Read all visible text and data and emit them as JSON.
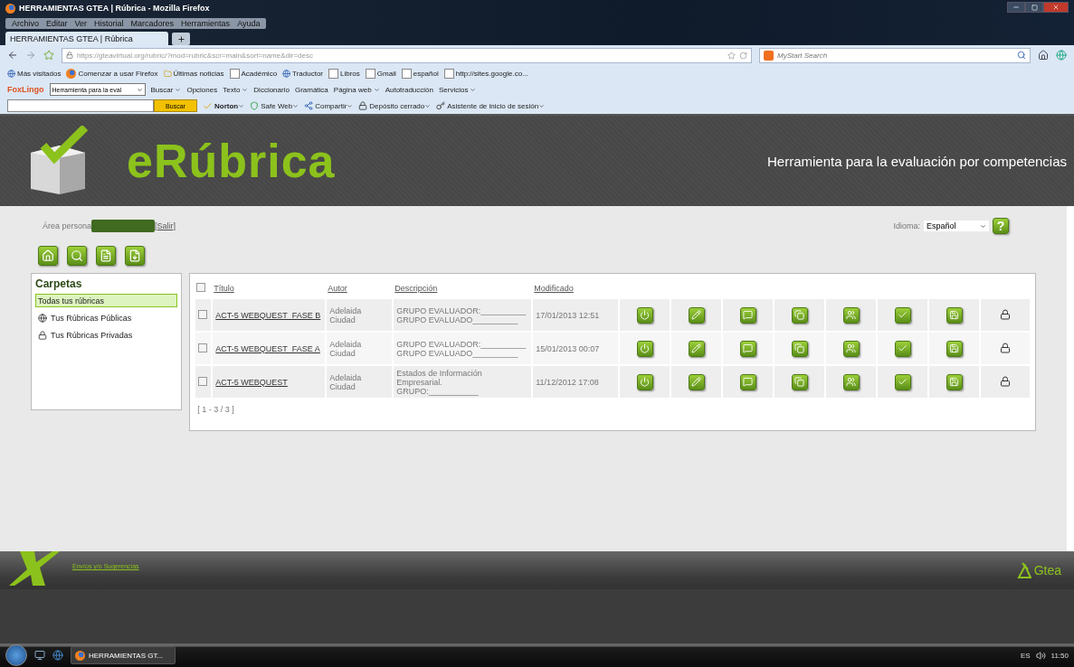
{
  "window": {
    "title": "HERRAMIENTAS GTEA | Rúbrica - Mozilla Firefox"
  },
  "menu": [
    "Archivo",
    "Editar",
    "Ver",
    "Historial",
    "Marcadores",
    "Herramientas",
    "Ayuda"
  ],
  "tabs": [
    {
      "label": "HERRAMIENTAS GTEA | Rúbrica",
      "selected": true
    }
  ],
  "address_bar": {
    "url": "https://gteavirtual.org/rubric/?mod=rubric&scr=main&sort=name&dir=desc"
  },
  "search_bar": {
    "placeholder": "MyStart Search"
  },
  "bookmarks": [
    {
      "label": "Más visitados",
      "kind": "page"
    },
    {
      "label": "Comenzar a usar Firefox",
      "kind": "firefox"
    },
    {
      "label": "Últimas noticias",
      "kind": "feed"
    },
    {
      "label": "Académico",
      "kind": "blank"
    },
    {
      "label": "Traductor",
      "kind": "page"
    },
    {
      "label": "Libros",
      "kind": "blank"
    },
    {
      "label": "Gmail",
      "kind": "blank"
    },
    {
      "label": "español",
      "kind": "blank"
    },
    {
      "label": "http://sites.google.co...",
      "kind": "blank"
    }
  ],
  "foxlingo_toolbar": {
    "brand": "FoxLingo",
    "language_select": "Herramienta para la eval",
    "items": [
      {
        "label": "Buscar",
        "menu": true
      },
      {
        "label": "Opciones",
        "menu": false
      },
      {
        "label": "Texto",
        "menu": true
      },
      {
        "label": "Diccionario",
        "menu": false
      },
      {
        "label": "Gramática",
        "menu": false
      },
      {
        "label": "Página web",
        "menu": true
      },
      {
        "label": "Autotraducción",
        "menu": false
      },
      {
        "label": "Servicios",
        "menu": true
      }
    ]
  },
  "norton_toolbar": {
    "search_button": "Buscar",
    "items": [
      {
        "label": "Norton",
        "menu": true,
        "kind": "norton"
      },
      {
        "label": "Safe Web",
        "menu": true,
        "kind": "safeweb"
      },
      {
        "label": "Compartir",
        "menu": true,
        "kind": "share"
      },
      {
        "label": "Depósito cerrado",
        "menu": true,
        "kind": "vault"
      },
      {
        "label": "Asistente de inicio de sesión",
        "menu": true,
        "kind": "login"
      }
    ]
  },
  "page": {
    "logo_text": "eRúbrica",
    "tagline": "Herramienta para la evaluación por competencias",
    "user_label": "Área persona",
    "logout": "[Salir]",
    "language_label": "Idioma:",
    "language": "Español",
    "help": "?",
    "folders": {
      "title": "Carpetas",
      "items": [
        {
          "label": "Todas tus rúbricas",
          "kind": "all",
          "selected": true
        },
        {
          "label": "Tus Rúbricas Públicas",
          "kind": "public",
          "selected": false
        },
        {
          "label": "Tus Rúbricas Privadas",
          "kind": "private",
          "selected": false
        }
      ]
    },
    "table": {
      "all_checked": false,
      "columns": [
        "Título",
        "Autor",
        "Descripción",
        "Modificado"
      ],
      "rows": [
        {
          "title": "ACT-5 WEBQUEST_FASE B",
          "author": "Adelaida Ciudad",
          "description": [
            "GRUPO EVALUADOR:__________",
            "GRUPO EVALUADO__________"
          ],
          "modified": "17/01/2013 12:51",
          "checked": false
        },
        {
          "title": "ACT-5 WEBQUEST_FASE A",
          "author": "Adelaida Ciudad",
          "description": [
            "GRUPO EVALUADOR:__________",
            "GRUPO EVALUADO__________"
          ],
          "modified": "15/01/2013 00:07",
          "checked": false
        },
        {
          "title": "ACT-5 WEBQUEST",
          "author": "Adelaida Ciudad",
          "description": [
            "Estados de Información Empresarial.",
            "GRUPO:___________"
          ],
          "modified": "11/12/2012 17:08",
          "checked": false
        }
      ]
    },
    "pager": "[ 1 - 3 / 3 ]",
    "footer_link": "Envíos y/o Sugerencias",
    "footer_logo": "Gtea"
  },
  "taskbar": {
    "tasks": [
      {
        "label": "HERRAMIENTAS GT...",
        "selected": true
      }
    ],
    "language": "ES",
    "time": "11:50"
  }
}
